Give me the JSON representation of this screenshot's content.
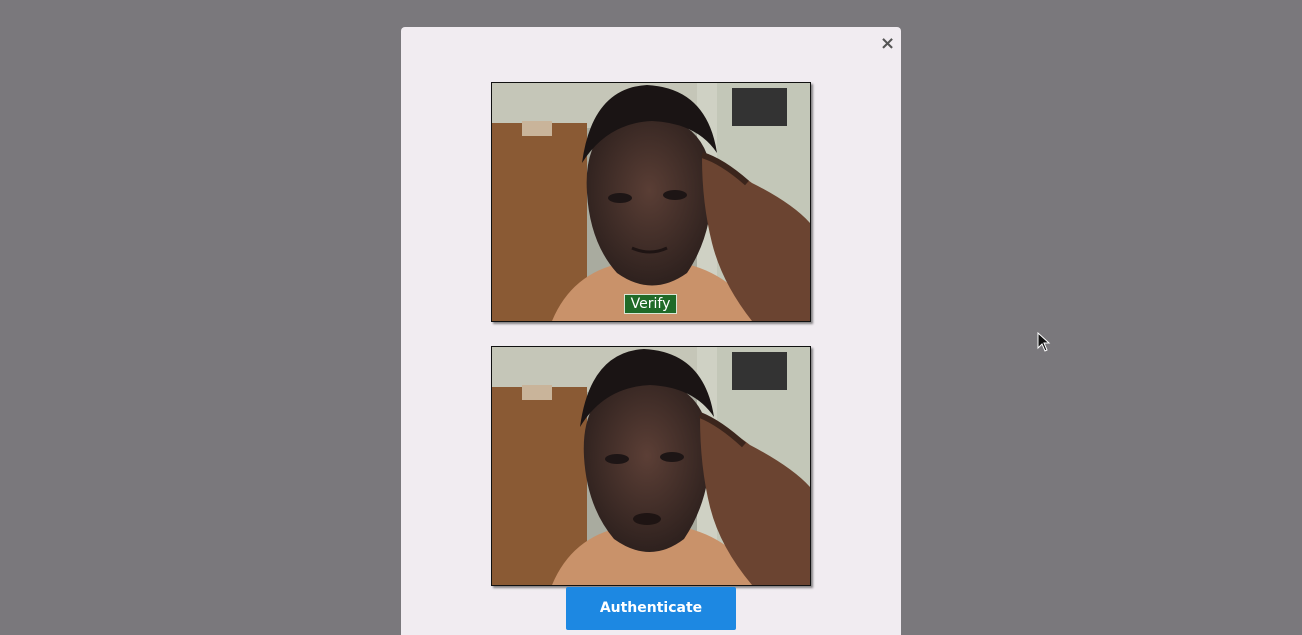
{
  "modal": {
    "close_label": "×",
    "camera_feed": {
      "overlay_button_label": "Verify"
    },
    "captured_photo": {},
    "authenticate_label": "Authenticate"
  },
  "colors": {
    "backdrop": "#7a787c",
    "modal_bg": "#f1ecf1",
    "verify_green": "#1f6a28",
    "authenticate_blue": "#1d88e2"
  },
  "icons": {
    "close": "close-icon",
    "cursor": "mouse-pointer-icon"
  }
}
